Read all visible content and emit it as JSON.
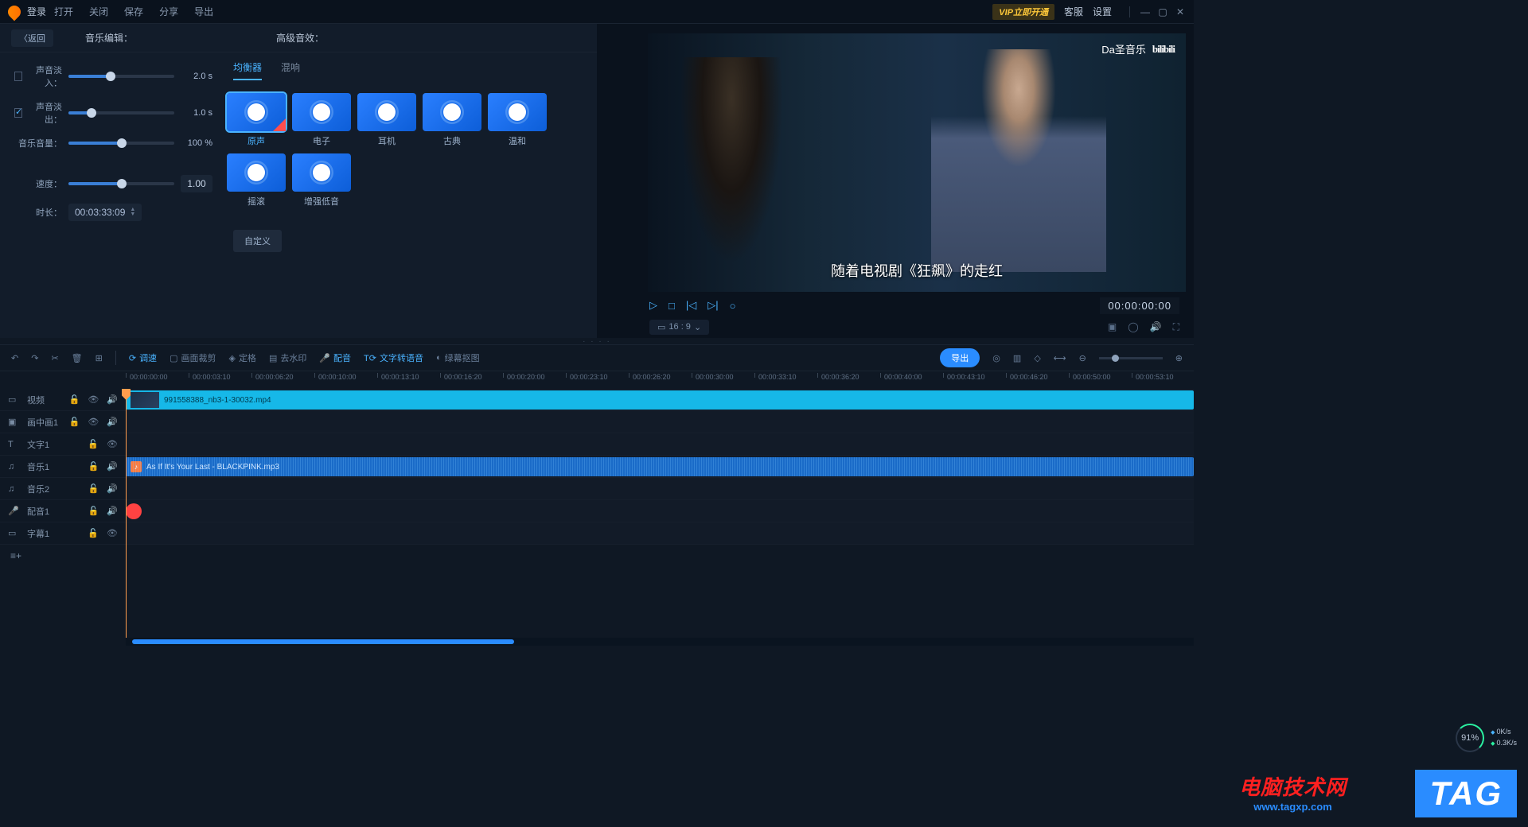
{
  "titlebar": {
    "login": "登录",
    "menu": [
      "打开",
      "关闭",
      "保存",
      "分享",
      "导出"
    ],
    "vip": "VIP立即开通",
    "right": [
      "客服",
      "设置"
    ]
  },
  "panel": {
    "back": "〈返回",
    "title_music": "音乐编辑：",
    "title_fx": "高级音效：",
    "fadein_label": "声音淡入：",
    "fadein_val": "2.0 s",
    "fadeout_label": "声音淡出：",
    "fadeout_val": "1.0 s",
    "volume_label": "音乐音量：",
    "volume_val": "100 %",
    "speed_label": "速度：",
    "speed_val": "1.00",
    "duration_label": "时长：",
    "duration_val": "00:03:33:09"
  },
  "fx": {
    "tab_eq": "均衡器",
    "tab_reverb": "混响",
    "presets": [
      "原声",
      "电子",
      "耳机",
      "古典",
      "温和",
      "摇滚",
      "增强低音"
    ],
    "custom": "自定义"
  },
  "preview": {
    "overlay_author": "Da圣音乐",
    "overlay_logo": "bilibili",
    "subtitle": "随着电视剧《狂飙》的走红",
    "timecode": "00:00:00:00",
    "ratio": "16 : 9"
  },
  "toolbar": {
    "speed": "调速",
    "crop": "画面裁剪",
    "freeze": "定格",
    "nowm": "去水印",
    "dub": "配音",
    "tts": "文字转语音",
    "greenscreen": "绿幕抠图",
    "export": "导出"
  },
  "ruler": [
    "00:00:00:00",
    "00:00:03:10",
    "00:00:06:20",
    "00:00:10:00",
    "00:00:13:10",
    "00:00:16:20",
    "00:00:20:00",
    "00:00:23:10",
    "00:00:26:20",
    "00:00:30:00",
    "00:00:33:10",
    "00:00:36:20",
    "00:00:40:00",
    "00:00:43:10",
    "00:00:46:20",
    "00:00:50:00",
    "00:00:53:10"
  ],
  "tracks": {
    "video": "视频",
    "pip": "画中画1",
    "text": "文字1",
    "music1": "音乐1",
    "music2": "音乐2",
    "dub": "配音1",
    "subtitle": "字幕1",
    "clip_video": "991558388_nb3-1-30032.mp4",
    "clip_audio": "As If It's Your Last - BLACKPINK.mp3"
  },
  "net": {
    "pct": "91%",
    "up": "0K/s",
    "down": "0.3K/s"
  },
  "watermark": {
    "site_name": "电脑技术网",
    "url": "www.tagxp.com",
    "tag": "TAG"
  }
}
